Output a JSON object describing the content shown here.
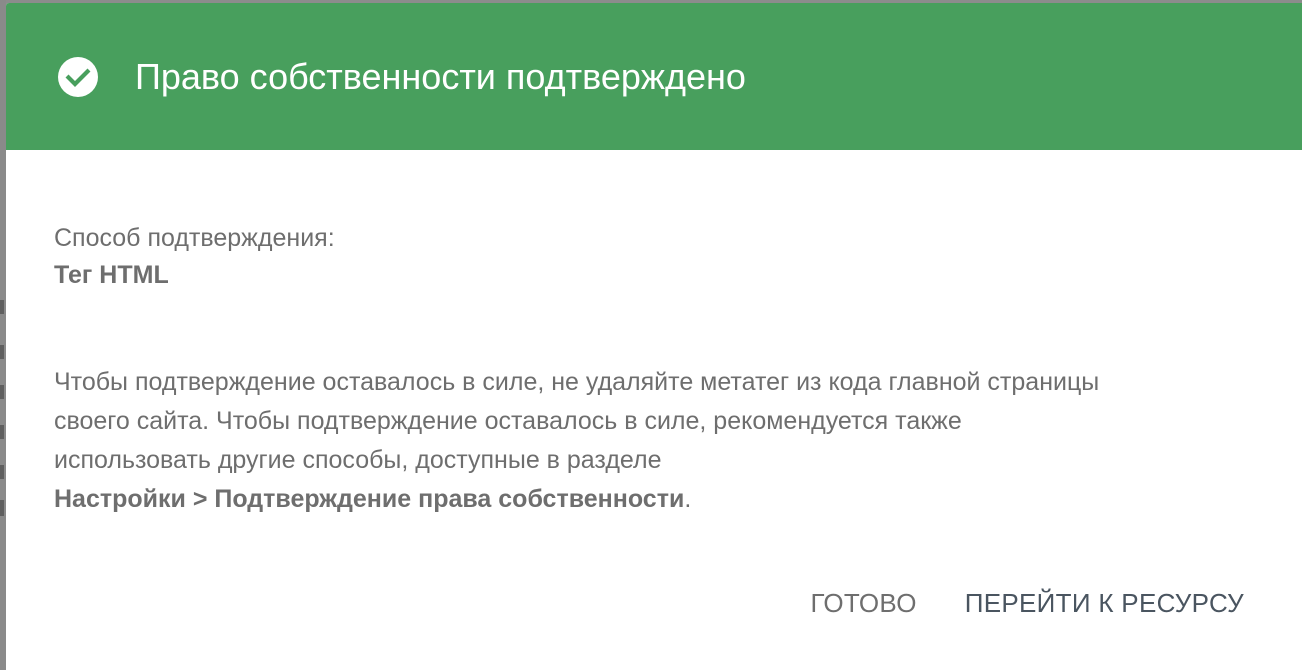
{
  "dialog": {
    "title": "Право собственности подтверждено",
    "icon": "check-circle-icon",
    "header_color": "#489f5d",
    "method_label": "Способ подтверждения:",
    "method_value": "Тег HTML",
    "body_line_1": "Чтобы подтверждение оставалось в силе, не удаляйте метатег из кода главной страницы",
    "body_line_2": "своего сайта. Чтобы подтверждение оставалось в силе, рекомендуется также",
    "body_line_3": "использовать другие способы, доступные в разделе",
    "body_link_path": "Настройки > Подтверждение права собственности",
    "body_link_suffix": ".",
    "actions": {
      "done_label": "ГОТОВО",
      "go_label": "ПЕРЕЙТИ К РЕСУРСУ"
    }
  }
}
